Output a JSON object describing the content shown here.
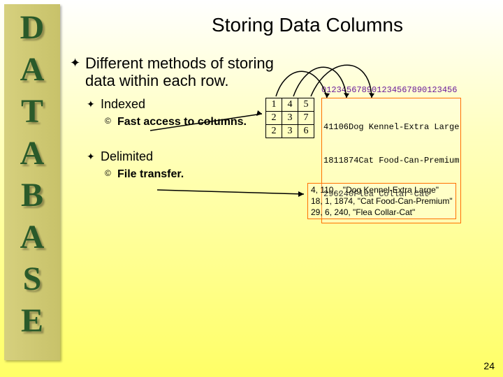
{
  "sidebar_letters": [
    "D",
    "A",
    "T",
    "A",
    "B",
    "A",
    "S",
    "E"
  ],
  "title": "Storing Data Columns",
  "bullets": {
    "main": "Different methods of storing data within each row.",
    "indexed": "Indexed",
    "indexed_sub": "Fast access to columns.",
    "delimited": "Delimited",
    "delimited_sub": "File transfer."
  },
  "ruler_text": "012345678901234567890123456",
  "grid": [
    [
      "1",
      "4",
      "5"
    ],
    [
      "2",
      "3",
      "7"
    ],
    [
      "2",
      "3",
      "6"
    ]
  ],
  "fixed_rows": [
    "41106Dog Kennel-Extra Large",
    "1811874Cat Food-Can-Premium",
    "296240Flea Collar-Cat"
  ],
  "delim_rows": [
    "4, 110, , \"Dog Kennel-Extra Large\"",
    "18, 1, 1874, \"Cat Food-Can-Premium\"",
    "29, 6, 240, \"Flea Collar-Cat\""
  ],
  "page_number": "24"
}
